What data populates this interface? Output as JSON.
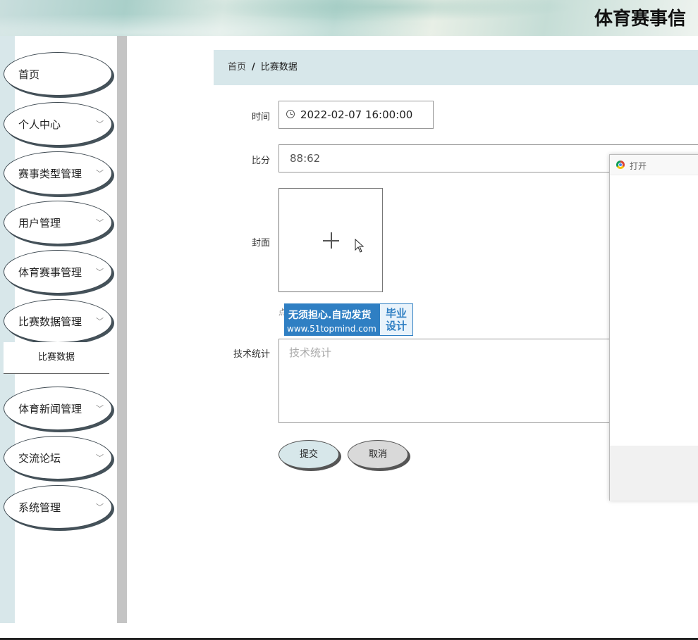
{
  "header": {
    "title": "体育赛事信"
  },
  "sidebar": {
    "items": [
      {
        "label": "首页",
        "has_chevron": false
      },
      {
        "label": "个人中心",
        "has_chevron": true
      },
      {
        "label": "赛事类型管理",
        "has_chevron": true
      },
      {
        "label": "用户管理",
        "has_chevron": true
      },
      {
        "label": "体育赛事管理",
        "has_chevron": true
      },
      {
        "label": "比赛数据管理",
        "has_chevron": true
      },
      {
        "label": "体育新闻管理",
        "has_chevron": true
      },
      {
        "label": "交流论坛",
        "has_chevron": true
      },
      {
        "label": "系统管理",
        "has_chevron": true
      }
    ],
    "subitem": "比赛数据"
  },
  "breadcrumb": {
    "home": "首页",
    "separator": "/",
    "current": "比赛数据"
  },
  "form": {
    "time_label": "时间",
    "time_value": "2022-02-07 16:00:00",
    "score_label": "比分",
    "score_value": "88:62",
    "cover_label": "封面",
    "hint": "点",
    "stats_label": "技术统计",
    "stats_placeholder": "技术统计",
    "submit_label": "提交",
    "cancel_label": "取消"
  },
  "watermark": {
    "line1": "无须担心.自动发货",
    "url": "www.51topmind.com",
    "badge_line1": "毕业",
    "badge_line2": "设计"
  },
  "dialog": {
    "title": "打开"
  },
  "colors": {
    "accent": "#d7e7ea",
    "sidebar_strip": "#d8e7ea",
    "watermark_blue": "#2f7fc3",
    "cancel_gray": "#d9d9d9"
  }
}
